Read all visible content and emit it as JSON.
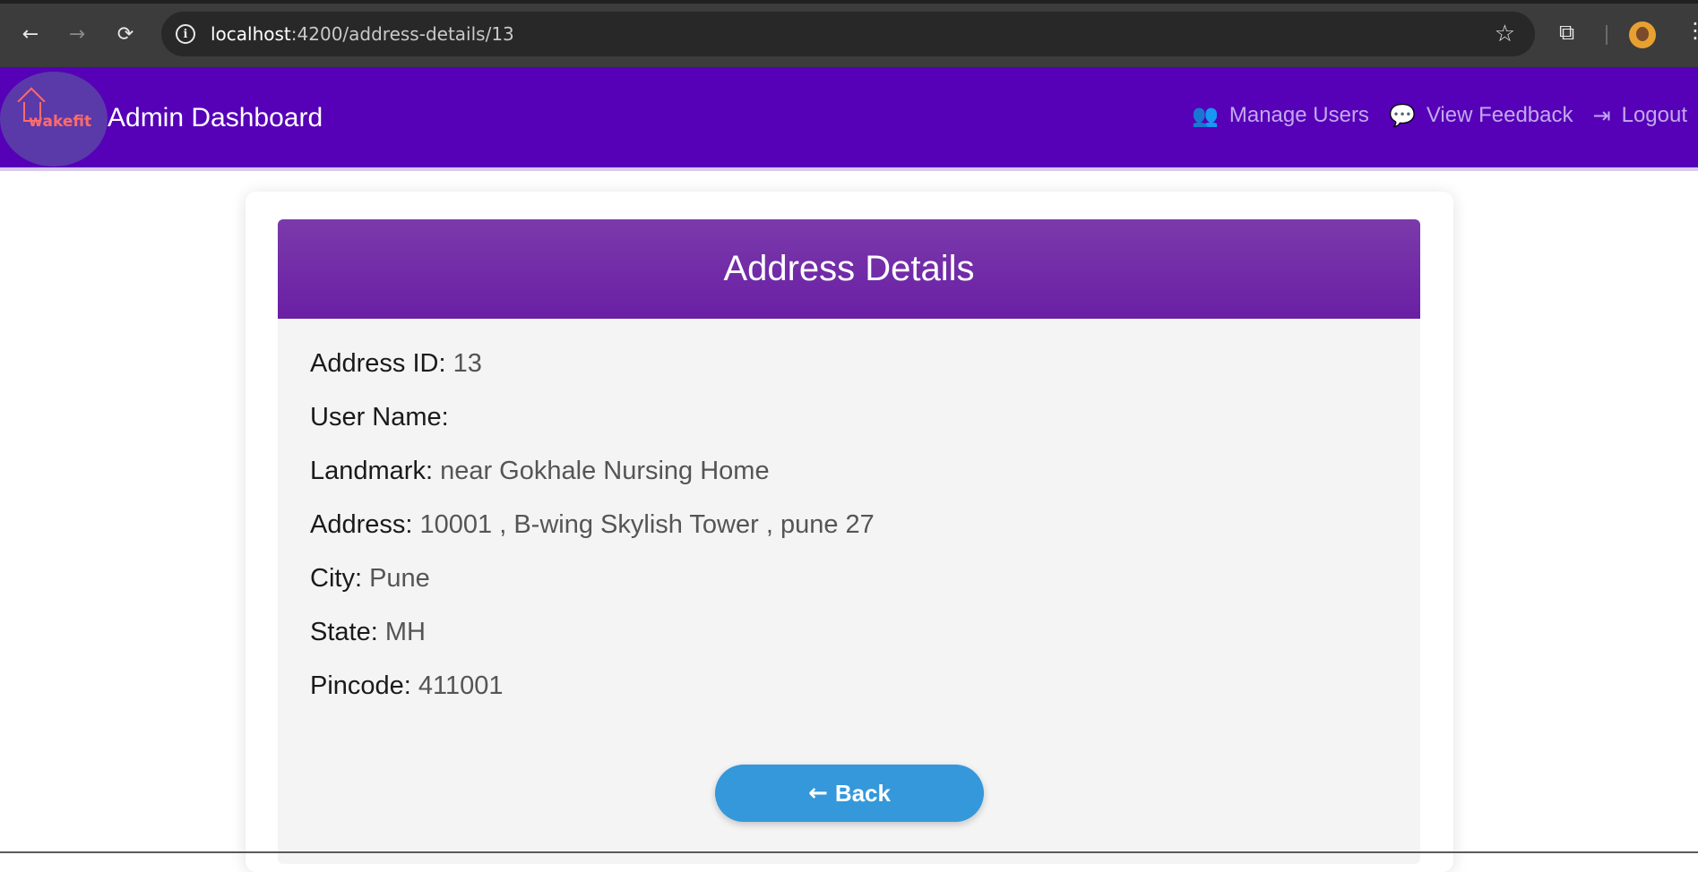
{
  "browser": {
    "url_host": "localhost",
    "url_path": ":4200/address-details/13",
    "back_glyph": "←",
    "forward_glyph": "→",
    "reload_glyph": "⟳",
    "info_glyph": "i",
    "star_glyph": "☆",
    "extensions_glyph": "⧉",
    "menu_glyph": "⋮"
  },
  "navbar": {
    "logo_text": "wakefit",
    "title": "Admin Dashboard",
    "links": [
      {
        "label": "Manage Users",
        "icon": "users-icon",
        "glyph": "👥"
      },
      {
        "label": "View Feedback",
        "icon": "comments-icon",
        "glyph": "💬"
      },
      {
        "label": "Logout",
        "icon": "logout-icon",
        "glyph": "⇥"
      }
    ]
  },
  "card": {
    "title": "Address Details",
    "fields": [
      {
        "label": "Address ID:",
        "value": "13"
      },
      {
        "label": "User Name:",
        "value": ""
      },
      {
        "label": "Landmark:",
        "value": "near Gokhale Nursing Home"
      },
      {
        "label": "Address:",
        "value": "10001 , B-wing Skylish Tower , pune 27"
      },
      {
        "label": "City:",
        "value": "Pune"
      },
      {
        "label": "State:",
        "value": "MH"
      },
      {
        "label": "Pincode:",
        "value": "411001"
      }
    ],
    "back_label": "Back",
    "back_glyph": "←"
  },
  "colors": {
    "navbar_bg": "#5600b8",
    "header_bg": "#7b3aab",
    "button_bg": "#3498db",
    "nav_link": "#c2a8ee"
  }
}
